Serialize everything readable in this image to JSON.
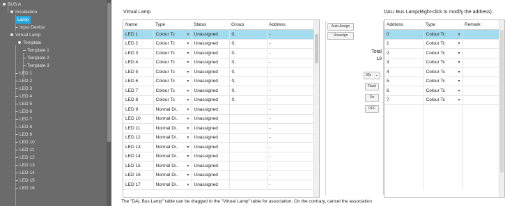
{
  "sidebar": {
    "items": [
      {
        "label": "BUS A",
        "kind": "bullet"
      },
      {
        "label": "Installation",
        "kind": "bullet"
      },
      {
        "label": "Lamp",
        "kind": "selected"
      },
      {
        "label": "Input Device",
        "kind": "dash"
      },
      {
        "label": "Virtual Lamp",
        "kind": "bullet"
      },
      {
        "label": "Template",
        "kind": "bullet"
      },
      {
        "label": "Template 1",
        "kind": "dash"
      },
      {
        "label": "Template 2",
        "kind": "dash"
      },
      {
        "label": "Template 3",
        "kind": "dash"
      },
      {
        "label": "LED 1",
        "kind": "dash"
      },
      {
        "label": "LED 2",
        "kind": "dash"
      },
      {
        "label": "LED 3",
        "kind": "dash"
      },
      {
        "label": "LED 4",
        "kind": "dash"
      },
      {
        "label": "LED 5",
        "kind": "dash"
      },
      {
        "label": "LED 6",
        "kind": "dash"
      },
      {
        "label": "LED 7",
        "kind": "dash"
      },
      {
        "label": "LED 8",
        "kind": "dash"
      },
      {
        "label": "LED 9",
        "kind": "dash"
      },
      {
        "label": "LED 10",
        "kind": "dash"
      },
      {
        "label": "LED 11",
        "kind": "dash"
      },
      {
        "label": "LED 12",
        "kind": "dash"
      },
      {
        "label": "LED 13",
        "kind": "dash"
      },
      {
        "label": "LED 14",
        "kind": "dash"
      },
      {
        "label": "LED 15",
        "kind": "dash"
      },
      {
        "label": "LED 16",
        "kind": "dash"
      }
    ]
  },
  "virtual": {
    "title": "Virtual Lamp",
    "headers": [
      "Name",
      "Type",
      "Status",
      "Group",
      "Address"
    ],
    "rows": [
      {
        "name": "LED 1",
        "type": "Colour Tc",
        "status": "Unassigned",
        "group": "0,",
        "address": "-"
      },
      {
        "name": "LED 2",
        "type": "Colour Tc",
        "status": "Unassigned",
        "group": "0,",
        "address": "-"
      },
      {
        "name": "LED 3",
        "type": "Colour Tc",
        "status": "Unassigned",
        "group": "0,",
        "address": "-"
      },
      {
        "name": "LED 4",
        "type": "Colour Tc",
        "status": "Unassigned",
        "group": "0,",
        "address": "-"
      },
      {
        "name": "LED 5",
        "type": "Colour Tc",
        "status": "Unassigned",
        "group": "0,",
        "address": "-"
      },
      {
        "name": "LED 6",
        "type": "Colour Tc",
        "status": "Unassigned",
        "group": "0,",
        "address": "-"
      },
      {
        "name": "LED 7",
        "type": "Colour Tc",
        "status": "Unassigned",
        "group": "0,",
        "address": "-"
      },
      {
        "name": "LED 8",
        "type": "Colour Tc",
        "status": "Unassigned",
        "group": "0,",
        "address": "-"
      },
      {
        "name": "LED 9",
        "type": "Normal Di..",
        "status": "Unassigned",
        "group": "",
        "address": "-"
      },
      {
        "name": "LED 10",
        "type": "Normal Di..",
        "status": "Unassigned",
        "group": "",
        "address": "-"
      },
      {
        "name": "LED 11",
        "type": "Normal Di..",
        "status": "Unassigned",
        "group": "",
        "address": "-"
      },
      {
        "name": "LED 12",
        "type": "Normal Di..",
        "status": "Unassigned",
        "group": "",
        "address": "-"
      },
      {
        "name": "LED 13",
        "type": "Normal Di..",
        "status": "Unassigned",
        "group": "",
        "address": "-"
      },
      {
        "name": "LED 14",
        "type": "Normal Di..",
        "status": "Unassigned",
        "group": "",
        "address": "-"
      },
      {
        "name": "LED 15",
        "type": "Normal Di..",
        "status": "Unassigned",
        "group": "",
        "address": "-"
      },
      {
        "name": "LED 16",
        "type": "Normal Di..",
        "status": "Unassigned",
        "group": "",
        "address": "-"
      },
      {
        "name": "LED 17",
        "type": "Normal Di..",
        "status": "Unassigned",
        "group": "",
        "address": "-"
      }
    ]
  },
  "controls": {
    "auto_assign": "Auto Assign",
    "unassign": "Unassign",
    "total_label": "Total",
    "total_value": "18",
    "select_value": "30s",
    "flash": "Flash",
    "on": "On",
    "off": "OFF"
  },
  "dali": {
    "title": "DALI Bus Lamp(Right-click to modify the address)",
    "headers": [
      "Address",
      "Type",
      "Remark"
    ],
    "rows": [
      {
        "address": "0",
        "type": "Colour Tc",
        "remark": ""
      },
      {
        "address": "1",
        "type": "Colour Tc",
        "remark": ""
      },
      {
        "address": "2",
        "type": "Colour Tc",
        "remark": ""
      },
      {
        "address": "3",
        "type": "Colour Tc",
        "remark": ""
      },
      {
        "address": "4",
        "type": "Colour Tc",
        "remark": ""
      },
      {
        "address": "5",
        "type": "Colour Tc",
        "remark": ""
      },
      {
        "address": "6",
        "type": "Colour Tc",
        "remark": ""
      },
      {
        "address": "7",
        "type": "Colour Tc",
        "remark": ""
      }
    ]
  },
  "footer": {
    "note": "The \"DAL Bus Lamp\" table can be dragged to the \"Virtual Lamp\" table for association; On the contrary, cancel the association"
  },
  "colors": {
    "sidebar_bg": "#6b6b6b",
    "selection": "#29a8e0",
    "row_selected": "#a3dcef"
  }
}
